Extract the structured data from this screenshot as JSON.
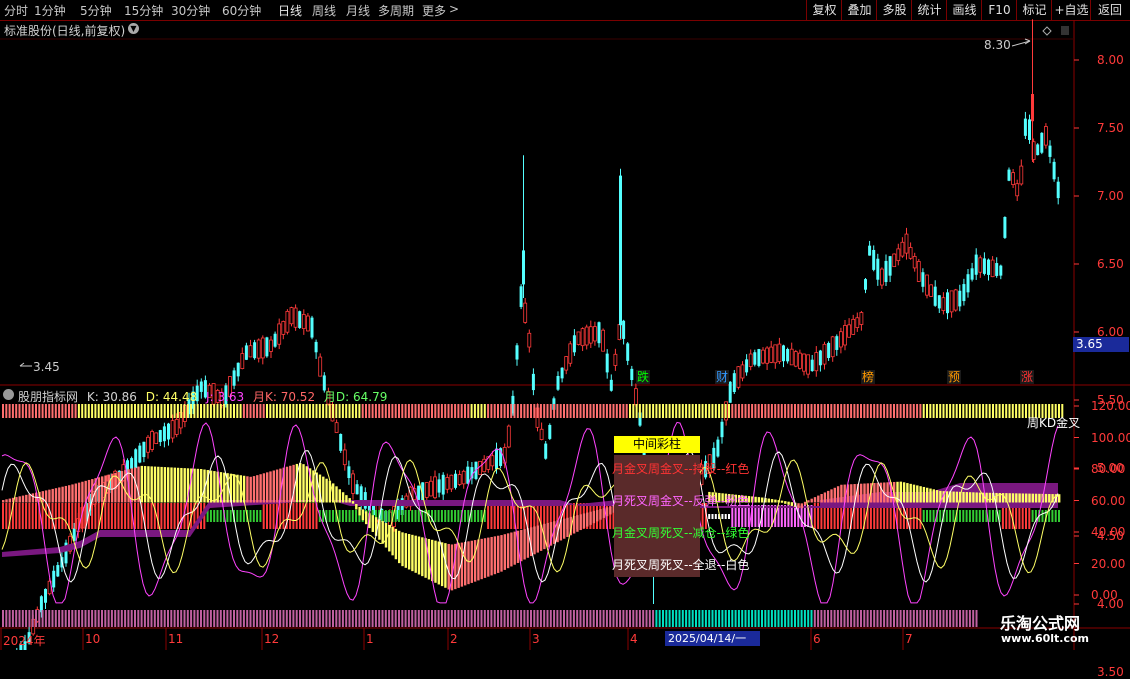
{
  "toolbar": {
    "timeframes": [
      "分时",
      "1分钟",
      "5分钟",
      "15分钟",
      "30分钟",
      "60分钟",
      "日线",
      "周线",
      "月线",
      "多周期",
      "更多"
    ],
    "right_buttons": [
      "复权",
      "叠加",
      "多股",
      "统计",
      "画线",
      "F10",
      "标记",
      "+自选",
      "返回"
    ]
  },
  "main_chart": {
    "title": "标准股份(日线,前复权)",
    "high_label": "8.30",
    "low_label": "3.45",
    "current_price": "3.65",
    "y_ticks": [
      "8.00",
      "7.50",
      "7.00",
      "6.50",
      "6.00",
      "5.50",
      "5.00",
      "4.50",
      "4.00",
      "3.50"
    ],
    "events": [
      {
        "label": "跌",
        "color": "#00ff00"
      },
      {
        "label": "财",
        "color": "#3399ff"
      },
      {
        "label": "榜",
        "color": "#ff9900"
      },
      {
        "label": "预",
        "color": "#ff9900"
      },
      {
        "label": "涨",
        "color": "#ff3333"
      }
    ],
    "up_color": "#ff3a3a",
    "down_color": "#54ffff"
  },
  "indicator": {
    "name": "股朋指标网",
    "k": "K: 30.86",
    "d": "D: 44.48",
    "j": "J: 3.63",
    "month_k": "月K: 70.52",
    "month_d": "月D: 64.79",
    "y_ticks": [
      "120.00",
      "100.00",
      "80.00",
      "60.00",
      "40.00",
      "20.00",
      "0.00"
    ],
    "week_kd_label": "周KD金叉",
    "legend_title": "中间彩柱",
    "legend_lines": [
      {
        "text": "月金叉周金叉--持股--红色",
        "color": "#ff3333"
      },
      {
        "text": "月死叉周金叉--反弹--粉色",
        "color": "#ff66ff"
      },
      {
        "text": "月金叉周死叉--减仓--绿色",
        "color": "#33ff33"
      },
      {
        "text": "月死叉周死叉--全退--白色",
        "color": "#ffffff"
      }
    ]
  },
  "time_axis": {
    "labels": [
      "2024年",
      "10",
      "11",
      "12",
      "1",
      "2",
      "3",
      "4",
      "6",
      "7"
    ],
    "current_date": "2025/04/14/一"
  },
  "watermark": {
    "line1": "乐淘公式网",
    "line2": "www.60lt.com"
  }
}
